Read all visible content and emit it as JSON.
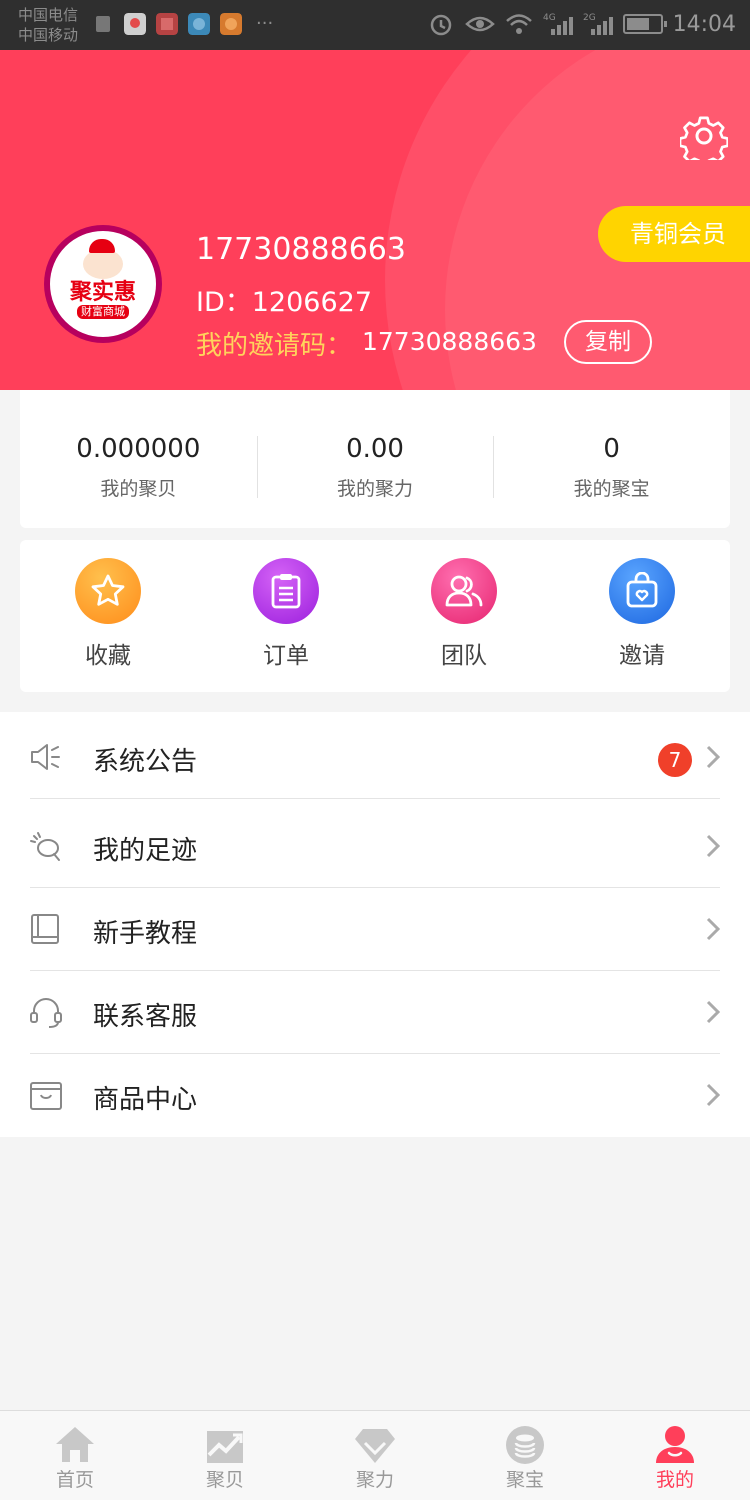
{
  "status_bar": {
    "carrier_1": "中国电信",
    "carrier_2": "中国移动",
    "signal_labels": [
      "4G",
      "2G"
    ],
    "time": "14:04",
    "battery_level": 0.7
  },
  "header": {
    "member_badge": "青铜会员",
    "avatar_title": "聚实惠",
    "avatar_subtitle": "财富商城",
    "phone": "17730888663",
    "id_text": "ID：1206627",
    "invite_label": "我的邀请码：",
    "invite_code": "17730888663",
    "copy_label": "复制"
  },
  "stats": [
    {
      "value": "0.000000",
      "label": "我的聚贝"
    },
    {
      "value": "0.00",
      "label": "我的聚力"
    },
    {
      "value": "0",
      "label": "我的聚宝"
    }
  ],
  "quick_actions": [
    {
      "label": "收藏",
      "icon": "star-icon",
      "color": "#ffa11a"
    },
    {
      "label": "订单",
      "icon": "clipboard-icon",
      "color": "#b232e6"
    },
    {
      "label": "团队",
      "icon": "team-icon",
      "color": "#f03d8e"
    },
    {
      "label": "邀请",
      "icon": "invite-bag-icon",
      "color": "#2f7dee"
    }
  ],
  "menu": [
    {
      "label": "系统公告",
      "icon": "speaker-icon",
      "badge": "7"
    },
    {
      "label": "我的足迹",
      "icon": "footprint-icon"
    },
    {
      "label": "新手教程",
      "icon": "book-icon"
    },
    {
      "label": "联系客服",
      "icon": "headset-icon"
    },
    {
      "label": "商品中心",
      "icon": "box-icon"
    }
  ],
  "tabs": [
    {
      "label": "首页",
      "icon": "home-icon",
      "active": false
    },
    {
      "label": "聚贝",
      "icon": "trend-icon",
      "active": false
    },
    {
      "label": "聚力",
      "icon": "diamond-icon",
      "active": false
    },
    {
      "label": "聚宝",
      "icon": "coin-stack-icon",
      "active": false
    },
    {
      "label": "我的",
      "icon": "user-icon",
      "active": true
    }
  ],
  "colors": {
    "brand": "#ff3f5a",
    "gold": "#ffd400",
    "invite_text": "#ffd35c",
    "badge_red": "#f0402a"
  }
}
